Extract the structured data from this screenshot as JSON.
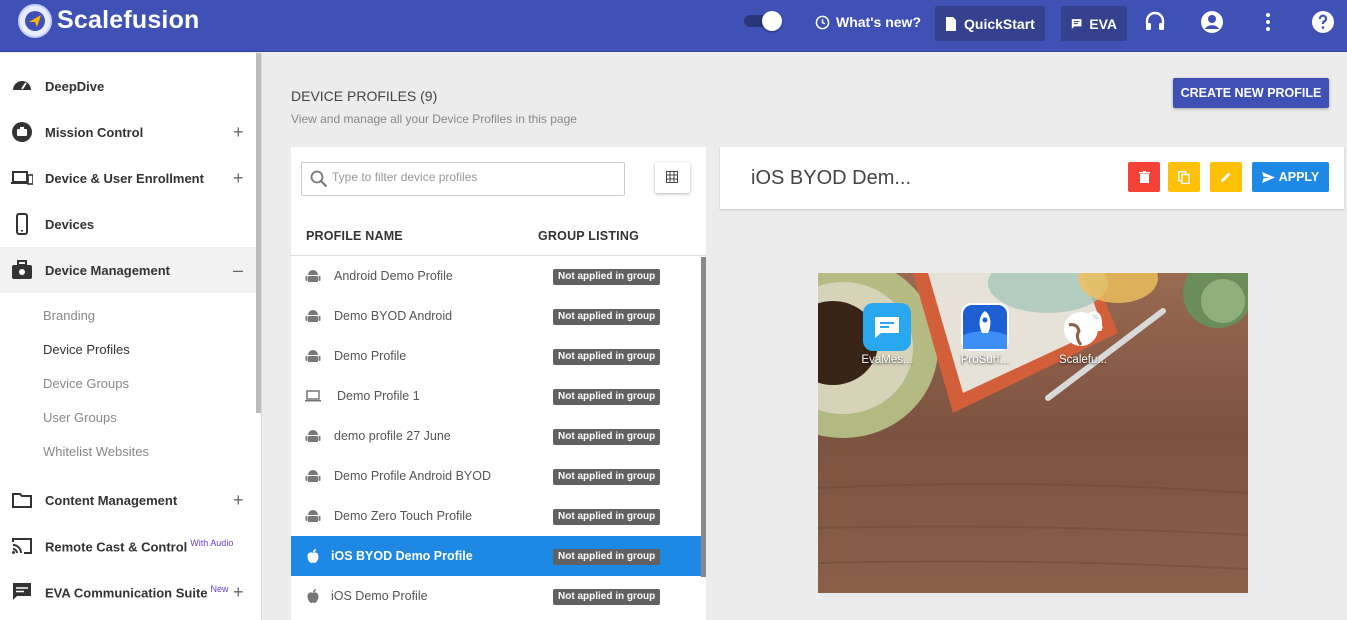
{
  "header": {
    "brand": "Scalefusion",
    "whats_new": "What's new?",
    "quickstart": "QuickStart",
    "eva": "EVA",
    "colors": {
      "bar": "#3f51b5",
      "button": "#33418f"
    }
  },
  "sidebar": {
    "items": [
      {
        "label": "DeepDive",
        "icon": "speedometer-icon",
        "expand": ""
      },
      {
        "label": "Mission Control",
        "icon": "briefcase-circle-icon",
        "expand": "+"
      },
      {
        "label": "Device & User Enrollment",
        "icon": "devices-icon",
        "expand": "+"
      },
      {
        "label": "Devices",
        "icon": "phone-icon",
        "expand": ""
      },
      {
        "label": "Device Management",
        "icon": "toolbox-icon",
        "expand": "–"
      },
      {
        "label": "Content Management",
        "icon": "folder-icon",
        "expand": "+"
      },
      {
        "label": "Remote Cast & Control",
        "icon": "cast-icon",
        "expand": "",
        "sup": "With Audio"
      },
      {
        "label": "EVA Communication Suite",
        "icon": "chat-icon",
        "expand": "+",
        "sup": "New"
      }
    ],
    "sub_items": [
      "Branding",
      "Device Profiles",
      "Device Groups",
      "User Groups",
      "Whitelist Websites"
    ]
  },
  "main": {
    "title": "DEVICE PROFILES (9)",
    "subtitle": "View and manage all your Device Profiles in this page",
    "create_button": "CREATE NEW PROFILE",
    "search_placeholder": "Type to filter device profiles",
    "columns": [
      "PROFILE NAME",
      "GROUP LISTING"
    ],
    "profiles": [
      {
        "name": "Android Demo Profile",
        "platform": "android",
        "group": "Not applied in group"
      },
      {
        "name": "Demo BYOD Android",
        "platform": "android",
        "group": "Not applied in group"
      },
      {
        "name": "Demo Profile",
        "platform": "android",
        "group": "Not applied in group"
      },
      {
        "name": "Demo Profile 1",
        "platform": "windows",
        "group": "Not applied in group"
      },
      {
        "name": "demo profile 27 June",
        "platform": "android",
        "group": "Not applied in group"
      },
      {
        "name": "Demo Profile Android BYOD",
        "platform": "android",
        "group": "Not applied in group"
      },
      {
        "name": "Demo Zero Touch Profile",
        "platform": "android",
        "group": "Not applied in group"
      },
      {
        "name": "iOS BYOD Demo Profile",
        "platform": "apple",
        "group": "Not applied in group",
        "selected": true
      },
      {
        "name": "iOS Demo Profile",
        "platform": "apple",
        "group": "Not applied in group"
      }
    ]
  },
  "detail": {
    "title": "iOS BYOD Dem...",
    "apply": "APPLY",
    "apps": [
      {
        "label": "EvaMes...",
        "icon": "chat-bubble-icon",
        "color": "#29a8f0"
      },
      {
        "label": "ProSurf...",
        "icon": "rocket-icon",
        "color": "#1e5fd6"
      },
      {
        "label": "Scalefu...",
        "icon": "globe-lock-icon",
        "color": "#ffffff"
      }
    ]
  }
}
